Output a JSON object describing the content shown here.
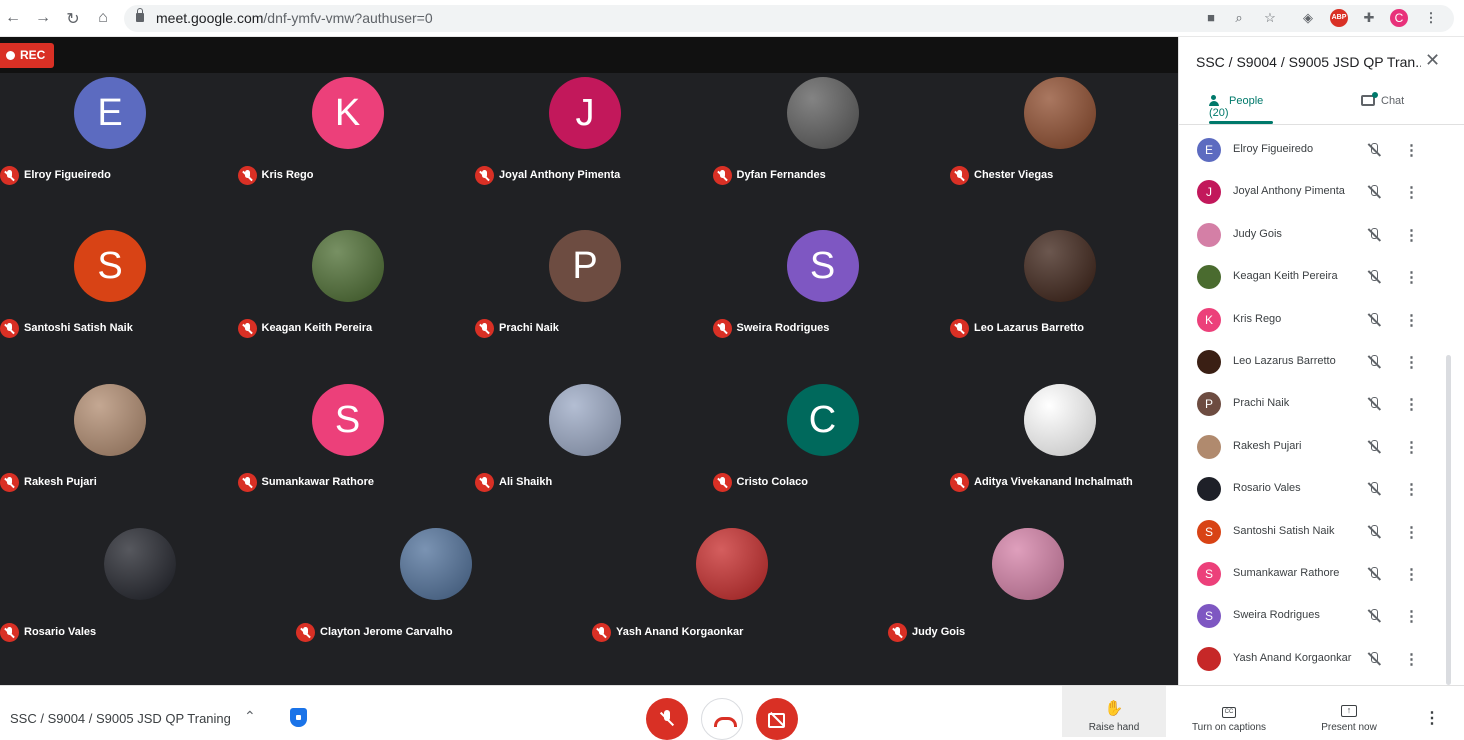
{
  "browser": {
    "url_host": "meet.google.com",
    "url_path": "/dnf-ymfv-vmw?authuser=0",
    "profile_initial": "C",
    "abp_label": "ABP",
    "nav_icons": [
      "back-arrow",
      "forward-arrow",
      "reload",
      "home"
    ]
  },
  "recording": {
    "label": "REC"
  },
  "tiles": [
    {
      "name": "Elroy Figueiredo",
      "initial": "E",
      "color": "#5c6bc0",
      "photo": false
    },
    {
      "name": "Kris Rego",
      "initial": "K",
      "color": "#ec407a",
      "photo": false
    },
    {
      "name": "Joyal Anthony Pimenta",
      "initial": "J",
      "color": "#c2185b",
      "photo": false
    },
    {
      "name": "Dyfan Fernandes",
      "initial": "",
      "color": "#5a5a5a",
      "photo": true
    },
    {
      "name": "Chester Viegas",
      "initial": "",
      "color": "#8d4a2b",
      "photo": true
    },
    {
      "name": "Santoshi Satish Naik",
      "initial": "S",
      "color": "#d84315",
      "photo": false
    },
    {
      "name": "Keagan Keith Pereira",
      "initial": "",
      "color": "#4a6b2f",
      "photo": true
    },
    {
      "name": "Prachi Naik",
      "initial": "P",
      "color": "#6d4c41",
      "photo": false
    },
    {
      "name": "Sweira Rodrigues",
      "initial": "S",
      "color": "#7e57c2",
      "photo": false
    },
    {
      "name": "Leo Lazarus Barretto",
      "initial": "",
      "color": "#3a1f14",
      "photo": true
    },
    {
      "name": "Rakesh Pujari",
      "initial": "",
      "color": "#b08a6e",
      "photo": true
    },
    {
      "name": "Sumankawar Rathore",
      "initial": "S",
      "color": "#ec407a",
      "photo": false
    },
    {
      "name": "Ali Shaikh",
      "initial": "",
      "color": "#9aa8c4",
      "photo": true
    },
    {
      "name": "Cristo Colaco",
      "initial": "C",
      "color": "#00695c",
      "photo": false
    },
    {
      "name": "Aditya Vivekanand Inchalmath",
      "initial": "",
      "color": "#ffffff",
      "photo": true
    },
    {
      "name": "Rosario Vales",
      "initial": "",
      "color": "#1e2028",
      "photo": true
    },
    {
      "name": "Clayton Jerome Carvalho",
      "initial": "",
      "color": "#4e6f99",
      "photo": true
    },
    {
      "name": "Yash Anand Korgaonkar",
      "initial": "",
      "color": "#c62828",
      "photo": true
    },
    {
      "name": "Judy Gois",
      "initial": "",
      "color": "#d47fa6",
      "photo": true
    }
  ],
  "sidebar": {
    "title": "SSC / S9004 / S9005 JSD QP Tran...",
    "tab_people": "People (20)",
    "tab_chat": "Chat",
    "participants": [
      {
        "name": "Elroy Figueiredo",
        "initial": "E",
        "color": "#5c6bc0"
      },
      {
        "name": "Joyal Anthony Pimenta",
        "initial": "J",
        "color": "#c2185b"
      },
      {
        "name": "Judy Gois",
        "initial": "",
        "color": "#d47fa6"
      },
      {
        "name": "Keagan Keith Pereira",
        "initial": "",
        "color": "#4a6b2f"
      },
      {
        "name": "Kris Rego",
        "initial": "K",
        "color": "#ec407a"
      },
      {
        "name": "Leo Lazarus Barretto",
        "initial": "",
        "color": "#3a1f14"
      },
      {
        "name": "Prachi Naik",
        "initial": "P",
        "color": "#6d4c41"
      },
      {
        "name": "Rakesh Pujari",
        "initial": "",
        "color": "#b08a6e"
      },
      {
        "name": "Rosario Vales",
        "initial": "",
        "color": "#1e2028"
      },
      {
        "name": "Santoshi Satish Naik",
        "initial": "S",
        "color": "#d84315"
      },
      {
        "name": "Sumankawar Rathore",
        "initial": "S",
        "color": "#ec407a"
      },
      {
        "name": "Sweira Rodrigues",
        "initial": "S",
        "color": "#7e57c2"
      },
      {
        "name": "Yash Anand Korgaonkar",
        "initial": "",
        "color": "#c62828"
      }
    ]
  },
  "bottombar": {
    "meeting_title": "SSC / S9004 / S9005 JSD QP Traning",
    "raise_hand": "Raise hand",
    "captions": "Turn on captions",
    "present": "Present now",
    "cc_glyph": "CC"
  }
}
